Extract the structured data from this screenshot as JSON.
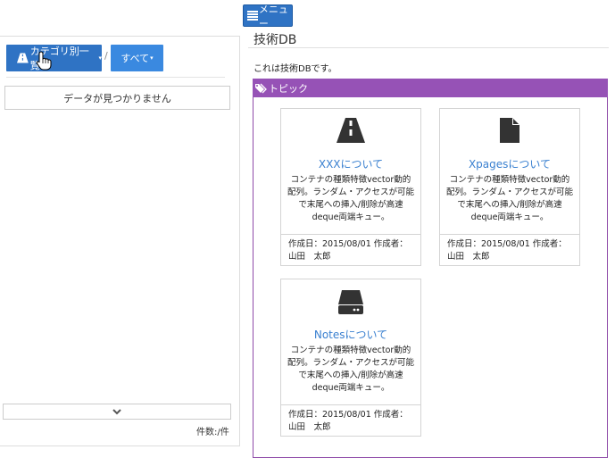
{
  "header": {
    "menu_label": "メニュー"
  },
  "left": {
    "category_label": "カテゴリ別一覧",
    "separator": "/",
    "all_label": "すべて",
    "not_found": "データが見つかりません",
    "count_label": "件数:",
    "count_value": "/件"
  },
  "main": {
    "title": "技術DB",
    "description": "これは技術DBです。",
    "topic_label": "トピック",
    "cards": [
      {
        "icon": "road-icon",
        "title": "XXXについて",
        "body": "コンテナの種類特徴vector動的配列。ランダム・アクセスが可能で末尾への挿入/削除が高速deque両端キュー。",
        "footer": "作成日：2015/08/01 作成者：山田　太郎"
      },
      {
        "icon": "file-icon",
        "title": "Xpagesについて",
        "body": "コンテナの種類特徴vector動的配列。ランダム・アクセスが可能で末尾への挿入/削除が高速deque両端キュー。",
        "footer": "作成日：2015/08/01 作成者：山田　太郎"
      },
      {
        "icon": "hdd-icon",
        "title": "Notesについて",
        "body": "コンテナの種類特徴vector動的配列。ランダム・アクセスが可能で末尾への挿入/削除が高速deque両端キュー。",
        "footer": "作成日：2015/08/01 作成者：山田　太郎"
      }
    ]
  },
  "colors": {
    "primary": "#2f73c4",
    "topic": "#9652b6",
    "link": "#3a80d0"
  }
}
